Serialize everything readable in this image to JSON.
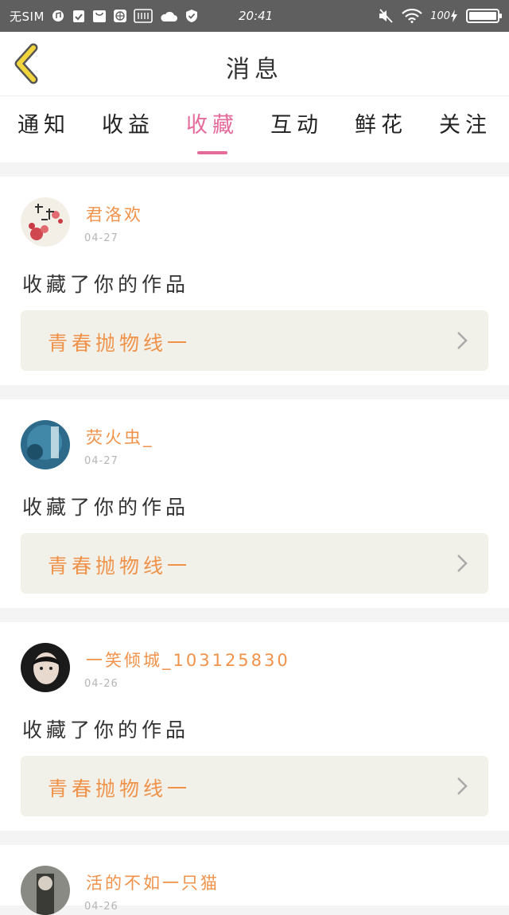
{
  "status_bar": {
    "carrier": "无SIM",
    "time": "20:41",
    "battery": "100"
  },
  "header": {
    "title": "消息"
  },
  "tabs": [
    {
      "label": "通知"
    },
    {
      "label": "收益"
    },
    {
      "label": "收藏"
    },
    {
      "label": "互动"
    },
    {
      "label": "鲜花"
    },
    {
      "label": "关注"
    }
  ],
  "active_tab": "收藏",
  "notifications": [
    {
      "user": "君洛欢",
      "date": "04-27",
      "action": "收藏了你的作品",
      "work": "青春抛物线一"
    },
    {
      "user": "荧火虫_",
      "date": "04-27",
      "action": "收藏了你的作品",
      "work": "青春抛物线一"
    },
    {
      "user": "一笑倾城_103125830",
      "date": "04-26",
      "action": "收藏了你的作品",
      "work": "青春抛物线一"
    },
    {
      "user": "活的不如一只猫",
      "date": "04-26"
    }
  ],
  "colors": {
    "accent_pink": "#e46a9b",
    "name_orange": "#f0924a",
    "back_yellow": "#f2d43c",
    "status_bar": "#5f5f5f"
  }
}
